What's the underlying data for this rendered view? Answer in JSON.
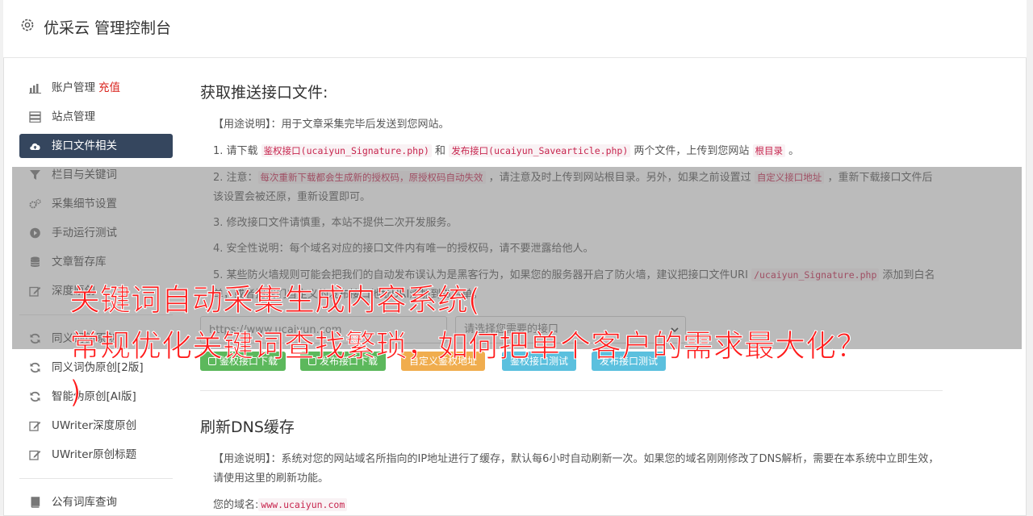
{
  "header": {
    "title": "优采云 管理控制台",
    "icon": "gear-icon"
  },
  "sidebar": {
    "items": [
      {
        "label": "账户管理",
        "badge": "充值",
        "icon": "bar-chart-icon"
      },
      {
        "label": "站点管理",
        "icon": "server-icon"
      },
      {
        "label": "接口文件相关",
        "icon": "cloud-upload-icon",
        "active": true
      },
      {
        "label": "栏目与关键词",
        "icon": "filter-icon"
      },
      {
        "label": "采集细节设置",
        "icon": "cogs-icon"
      },
      {
        "label": "手动运行测试",
        "icon": "play-circle-icon"
      },
      {
        "label": "文章暂存库",
        "icon": "database-icon"
      },
      {
        "label": "深度原创",
        "icon": "edit-icon"
      }
    ],
    "items2": [
      {
        "label": "同义词伪原创",
        "icon": "refresh-icon"
      },
      {
        "label": "同义词伪原创[2版]",
        "icon": "refresh-icon"
      },
      {
        "label": "智能伪原创[AI版]",
        "icon": "refresh-icon"
      },
      {
        "label": "UWriter深度原创",
        "icon": "edit-icon"
      },
      {
        "label": "UWriter原创标题",
        "icon": "edit-icon"
      }
    ],
    "items3": [
      {
        "label": "公有词库查询",
        "icon": "book-icon"
      }
    ]
  },
  "main": {
    "section1": {
      "title": "获取推送接口文件:",
      "usage": "【用途说明】：用于文章采集完毕后发送到您网站。",
      "p1": {
        "pre": "1. 请下载 ",
        "c1": "鉴权接口(ucaiyun_Signature.php)",
        "mid": " 和 ",
        "c2": "发布接口(ucaiyun_Savearticle.php)",
        "post": " 两个文件，上传到您网站 ",
        "c3": "根目录",
        "end": " 。"
      },
      "p2": {
        "pre": "2. 注意：",
        "c1": "每次重新下载都会生成新的授权码，原授权码自动失效",
        "mid": " ，请注意及时上传到网站根目录。另外，如果之前设置过 ",
        "c2": "自定义接口地址",
        "post": " ，重新下载接口文件后该设置会被还原，重新设置即可。"
      },
      "p3": "3. 修改接口文件请慎重，本站不提供二次开发服务。",
      "p4": "4. 安全性说明：每个域名对应的接口文件内有唯一的授权码，请不要泄露给他人。",
      "p5": {
        "pre": "5. 某些防火墙规则可能会把我们的自动发布误认为是黑客行为，如果您的服务器开启了防火墙，建议把接口文件URI ",
        "c1": "/ucaiyun_Signature.php",
        "post": " 添加到白名单，或者把我们自定义的发布接口地址URI添加到白名单。"
      },
      "url_value": "https://www.ucaiyun.com",
      "select_placeholder": "请选择您需要的接口",
      "buttons": [
        {
          "label": "鉴权接口下载",
          "color": "#5cb85c"
        },
        {
          "label": "发布接口下载",
          "color": "#5cb85c"
        },
        {
          "label": "自定义鉴权地址",
          "color": "#f0ad4e"
        },
        {
          "label": "鉴权接口测试",
          "color": "#5bc0de"
        },
        {
          "label": "发布接口测试",
          "color": "#5bc0de"
        }
      ]
    },
    "section2": {
      "title": "刷新DNS缓存",
      "usage": "【用途说明】：系统对您的网站域名所指向的IP地址进行了缓存，默认每6小时自动刷新一次。如果您的域名刚刚修改了DNS解析，需要在本系统中立即生效，请使用这里的刷新功能。",
      "domain_label": "您的域名:",
      "domain_value": "www.ucaiyun.com"
    }
  },
  "overlay": {
    "headline_line1": "关键词自动采集生成内容系统(",
    "headline_line2": "常规优化关键词查找繁琐，如何把单个客户的需求最大化？",
    "headline_line3": ")"
  },
  "colors": {
    "active_bg": "#35465e",
    "headline": "#ff1a1a",
    "code": "#c7254e"
  }
}
